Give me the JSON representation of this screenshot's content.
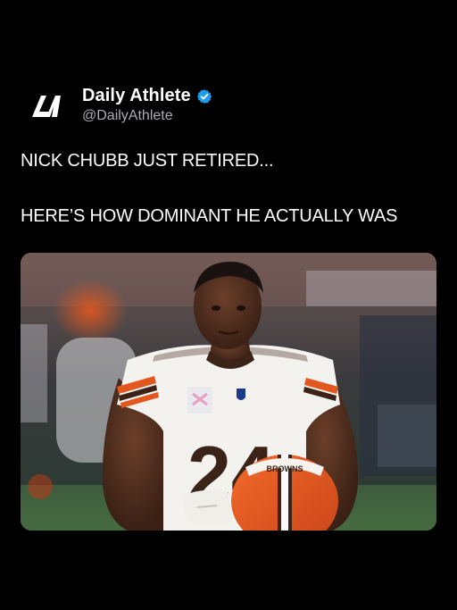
{
  "account": {
    "display_name": "Daily Athlete",
    "handle": "@DailyAthlete",
    "avatar_icon": "daily-athlete-logo",
    "verified_icon": "verified-badge-icon",
    "verified_color": "#1d9bf0"
  },
  "tweet": {
    "line1": "NICK CHUBB JUST RETIRED...",
    "line2": "HERE’S HOW DOMINANT HE ACTUALLY WAS"
  },
  "media": {
    "jersey_number": "24",
    "helmet_text": "BROWNS"
  },
  "colors": {
    "background": "#000000",
    "text": "#ffffff",
    "handle": "#a9adb1",
    "browns_orange": "#e2571e",
    "browns_brown": "#3b2417"
  }
}
